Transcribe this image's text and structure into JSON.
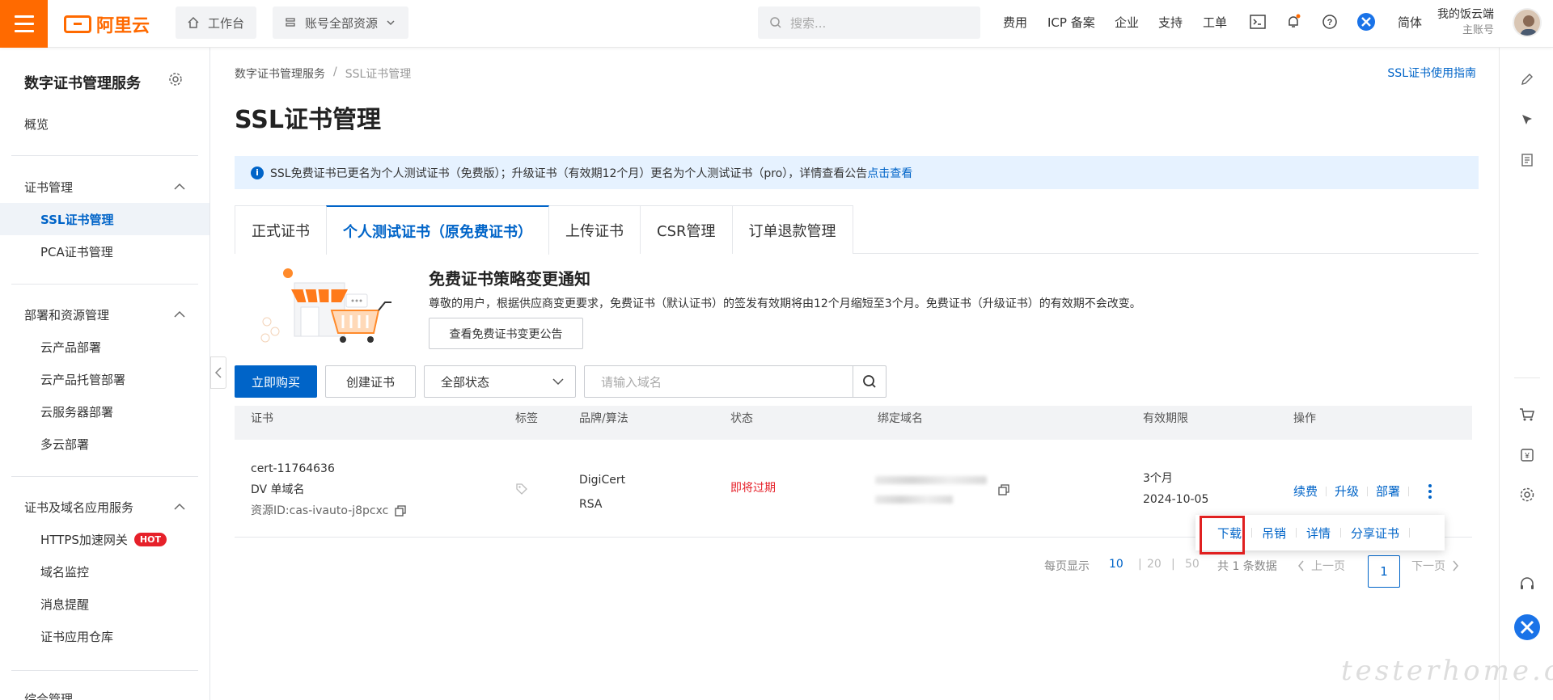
{
  "topbar": {
    "brand": "阿里云",
    "workbench": "工作台",
    "resources": "账号全部资源",
    "search_placeholder": "搜索...",
    "links": [
      "费用",
      "ICP 备案",
      "企业",
      "支持",
      "工单"
    ],
    "language": "简体",
    "user_name": "我的饭云端",
    "user_role": "主账号"
  },
  "sidebar": {
    "title": "数字证书管理服务",
    "overview": "概览",
    "groups": [
      {
        "label": "证书管理",
        "items": [
          "SSL证书管理",
          "PCA证书管理"
        ]
      },
      {
        "label": "部署和资源管理",
        "items": [
          "云产品部署",
          "云产品托管部署",
          "云服务器部署",
          "多云部署"
        ]
      },
      {
        "label": "证书及域名应用服务",
        "items": [
          "HTTPS加速网关",
          "域名监控",
          "消息提醒",
          "证书应用仓库"
        ]
      }
    ],
    "hot_badge": "HOT",
    "last_group_partial": "综合管理"
  },
  "breadcrumb": {
    "root": "数字证书管理服务",
    "separator": "/",
    "current": "SSL证书管理"
  },
  "guide_link": "SSL证书使用指南",
  "page_title": "SSL证书管理",
  "notice": {
    "text": "SSL免费证书已更名为个人测试证书（免费版）；升级证书（有效期12个月）更名为个人测试证书（pro），详情查看公告",
    "link": "点击查看"
  },
  "tabs": [
    "正式证书",
    "个人测试证书（原免费证书）",
    "上传证书",
    "CSR管理",
    "订单退款管理"
  ],
  "promo": {
    "title": "免费证书策略变更通知",
    "text": "尊敬的用户，根据供应商变更要求，免费证书（默认证书）的签发有效期将由12个月缩短至3个月。免费证书（升级证书）的有效期不会改变。",
    "button": "查看免费证书变更公告"
  },
  "toolbar": {
    "buy": "立即购买",
    "create": "创建证书",
    "status_select": "全部状态",
    "domain_placeholder": "请输入域名"
  },
  "table": {
    "columns": [
      "证书",
      "标签",
      "品牌/算法",
      "状态",
      "绑定域名",
      "有效期限",
      "操作"
    ],
    "rows": [
      {
        "cert_id": "cert-11764636",
        "cert_type": "DV 单域名",
        "resource_id": "资源ID:cas-ivauto-j8pcxc",
        "brand": "DigiCert",
        "algorithm": "RSA",
        "status": "即将过期",
        "validity": "3个月",
        "expiry": "2024-10-05",
        "ops": [
          "续费",
          "升级",
          "部署"
        ]
      }
    ]
  },
  "dropdown": [
    "下载",
    "吊销",
    "详情",
    "分享证书"
  ],
  "pagination": {
    "per_page_label": "每页显示",
    "sizes": [
      "10",
      "20",
      "50"
    ],
    "total": "共 1 条数据",
    "prev": "上一页",
    "current": "1",
    "next": "下一页"
  },
  "watermark": "testerhome.com",
  "colors": {
    "brand": "#ff6a00",
    "primary": "#0064c8",
    "danger": "#e6212a"
  }
}
